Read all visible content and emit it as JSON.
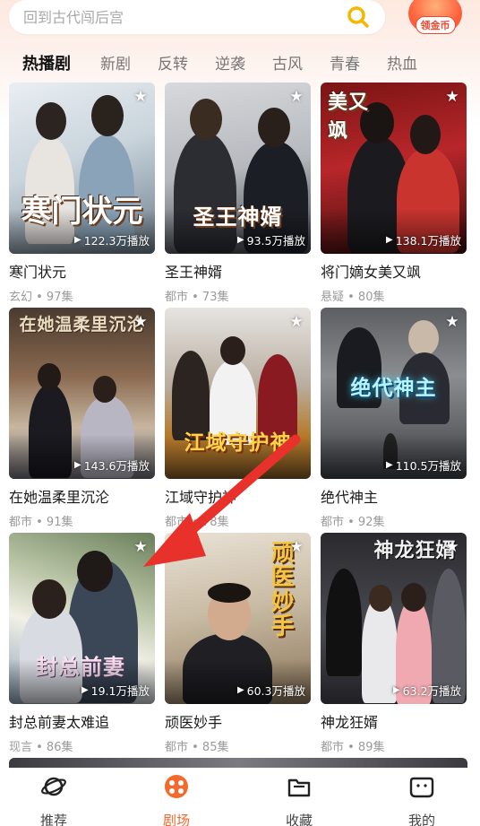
{
  "search": {
    "placeholder": "回到古代闯后宫"
  },
  "coin_button": {
    "label": "领金币"
  },
  "tabs": [
    {
      "label": "热播剧",
      "active": true
    },
    {
      "label": "新剧"
    },
    {
      "label": "反转"
    },
    {
      "label": "逆袭"
    },
    {
      "label": "古风"
    },
    {
      "label": "青春"
    },
    {
      "label": "热血"
    }
  ],
  "dramas": [
    {
      "title": "寒门状元",
      "genre_episodes": "玄幻 • 97集",
      "plays": "122.3万播放",
      "poster_text": "寒门状元"
    },
    {
      "title": "圣王神婿",
      "genre_episodes": "都市 • 73集",
      "plays": "93.5万播放",
      "poster_text": "圣王神婿"
    },
    {
      "title": "将门嫡女美又飒",
      "genre_episodes": "悬疑 • 80集",
      "plays": "138.1万播放",
      "poster_text": "美又飒"
    },
    {
      "title": "在她温柔里沉沦",
      "genre_episodes": "都市 • 91集",
      "plays": "143.6万播放",
      "poster_text": "在她温柔里沉沦"
    },
    {
      "title": "江域守护神",
      "genre_episodes": "都市 • 78集",
      "plays": "",
      "poster_text": "江域守护神"
    },
    {
      "title": "绝代神主",
      "genre_episodes": "都市 • 92集",
      "plays": "110.5万播放",
      "poster_text": "绝代神主"
    },
    {
      "title": "封总前妻太难追",
      "genre_episodes": "现言 • 86集",
      "plays": "19.1万播放",
      "poster_text": "封总前妻"
    },
    {
      "title": "顽医妙手",
      "genre_episodes": "都市 • 85集",
      "plays": "60.3万播放",
      "poster_text": "顽医妙手"
    },
    {
      "title": "神龙狂婿",
      "genre_episodes": "都市 • 89集",
      "plays": "63.2万播放",
      "poster_text": "神龙狂婿"
    }
  ],
  "bottom_nav": [
    {
      "label": "推荐",
      "icon": "planet-icon"
    },
    {
      "label": "剧场",
      "icon": "theater-icon",
      "active": true
    },
    {
      "label": "收藏",
      "icon": "folder-icon"
    },
    {
      "label": "我的",
      "icon": "profile-face-icon"
    }
  ],
  "colors": {
    "accent": "#f26a2d",
    "arrow": "#e8312a"
  }
}
